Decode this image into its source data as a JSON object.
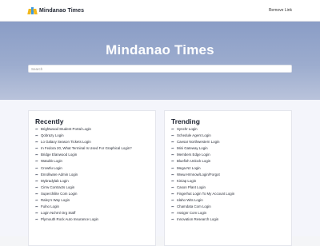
{
  "header": {
    "logo_text": "Mindanao Times",
    "remove_link": "Remove Link"
  },
  "hero": {
    "title": "Mindanao Times",
    "search_placeholder": "Search"
  },
  "colors": {
    "hero_top": "#8a9dc6",
    "hero_bottom": "#b9c3db",
    "logo_yellow": "#f2b81c",
    "logo_blue": "#3e9be0"
  },
  "recently": {
    "title": "Recently",
    "items": [
      "Brightwood Student Portal Login",
      "Qobrazy Login",
      "Lo Galaxy Season Tickets Login",
      "In Fedora 20, What Terminal Is Used For Graphical Login?",
      "Bridge Elanwood Login",
      "Watubb Login",
      "Crowtlu Login",
      "Enrollware Admin Login",
      "Mybradylab Login",
      "Cirrw Contracts Login",
      "Superchilite Com Login",
      "Raley's Way Login",
      "Fulno Login",
      "Login Nchrnl Org Staff",
      "Plymouth Rock Auto Insurance Login"
    ]
  },
  "trending": {
    "title": "Trending",
    "items": [
      "Synchr Login",
      "Schedule Agent Login",
      "Caesar Northwestern Login",
      "Mini Gateway Login",
      "Members Edge Login",
      "Bluefish Unlock Login",
      "Mega.Nz Login",
      "Www.Hrmnow/Login/Forgot",
      "Kiniap Login",
      "Cason Plant Login",
      "Fingerhut Login To My Account Login",
      "Idaho Wits Login",
      "Chamdata Com Login",
      "Assignr Com Login",
      "Innovation Research Login"
    ]
  }
}
